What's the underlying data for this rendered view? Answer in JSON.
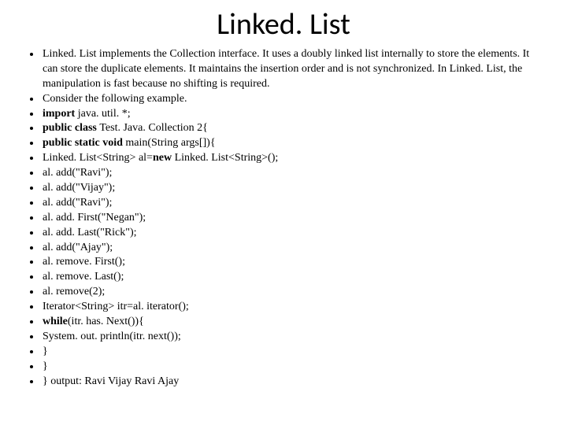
{
  "title": "Linked. List",
  "items": [
    {
      "segments": [
        {
          "t": "Linked. List implements the Collection interface. It uses a doubly linked list internally to store the elements. It can store the duplicate elements. It maintains the insertion order and is not synchronized. In Linked. List, the manipulation is fast because no shifting is required."
        }
      ]
    },
    {
      "segments": [
        {
          "t": "Consider the following example."
        }
      ]
    },
    {
      "segments": [
        {
          "t": "import ",
          "b": 1
        },
        {
          "t": "java. util. *;"
        }
      ]
    },
    {
      "segments": [
        {
          "t": "public class ",
          "b": 1
        },
        {
          "t": "Test. Java. Collection 2{"
        }
      ]
    },
    {
      "segments": [
        {
          "t": "public static void ",
          "b": 1
        },
        {
          "t": "main(String args[]){"
        }
      ]
    },
    {
      "segments": [
        {
          "t": "Linked. List<String> al="
        },
        {
          "t": "new ",
          "b": 1
        },
        {
          "t": "Linked. List<String>();"
        }
      ]
    },
    {
      "segments": [
        {
          "t": "al. add(\"Ravi\");"
        }
      ]
    },
    {
      "segments": [
        {
          "t": "al. add(\"Vijay\");"
        }
      ]
    },
    {
      "segments": [
        {
          "t": "al. add(\"Ravi\");"
        }
      ]
    },
    {
      "segments": [
        {
          "t": "al. add. First(\"Negan\");"
        }
      ]
    },
    {
      "segments": [
        {
          "t": "al. add. Last(\"Rick\");"
        }
      ]
    },
    {
      "segments": [
        {
          "t": "al. add(\"Ajay\");"
        }
      ]
    },
    {
      "segments": [
        {
          "t": "al. remove. First();"
        }
      ]
    },
    {
      "segments": [
        {
          "t": "al. remove. Last();"
        }
      ]
    },
    {
      "segments": [
        {
          "t": "al. remove(2);"
        }
      ]
    },
    {
      "segments": [
        {
          "t": "Iterator<String> itr=al. iterator();"
        }
      ]
    },
    {
      "segments": [
        {
          "t": "while",
          "b": 1
        },
        {
          "t": "(itr. has. Next()){"
        }
      ]
    },
    {
      "segments": [
        {
          "t": "System. out. println(itr. next());"
        }
      ]
    },
    {
      "segments": [
        {
          "t": "}"
        }
      ]
    },
    {
      "segments": [
        {
          "t": "}"
        }
      ]
    },
    {
      "segments": [
        {
          "t": "}  output:  Ravi   Vijay   Ravi   Ajay"
        }
      ]
    }
  ]
}
